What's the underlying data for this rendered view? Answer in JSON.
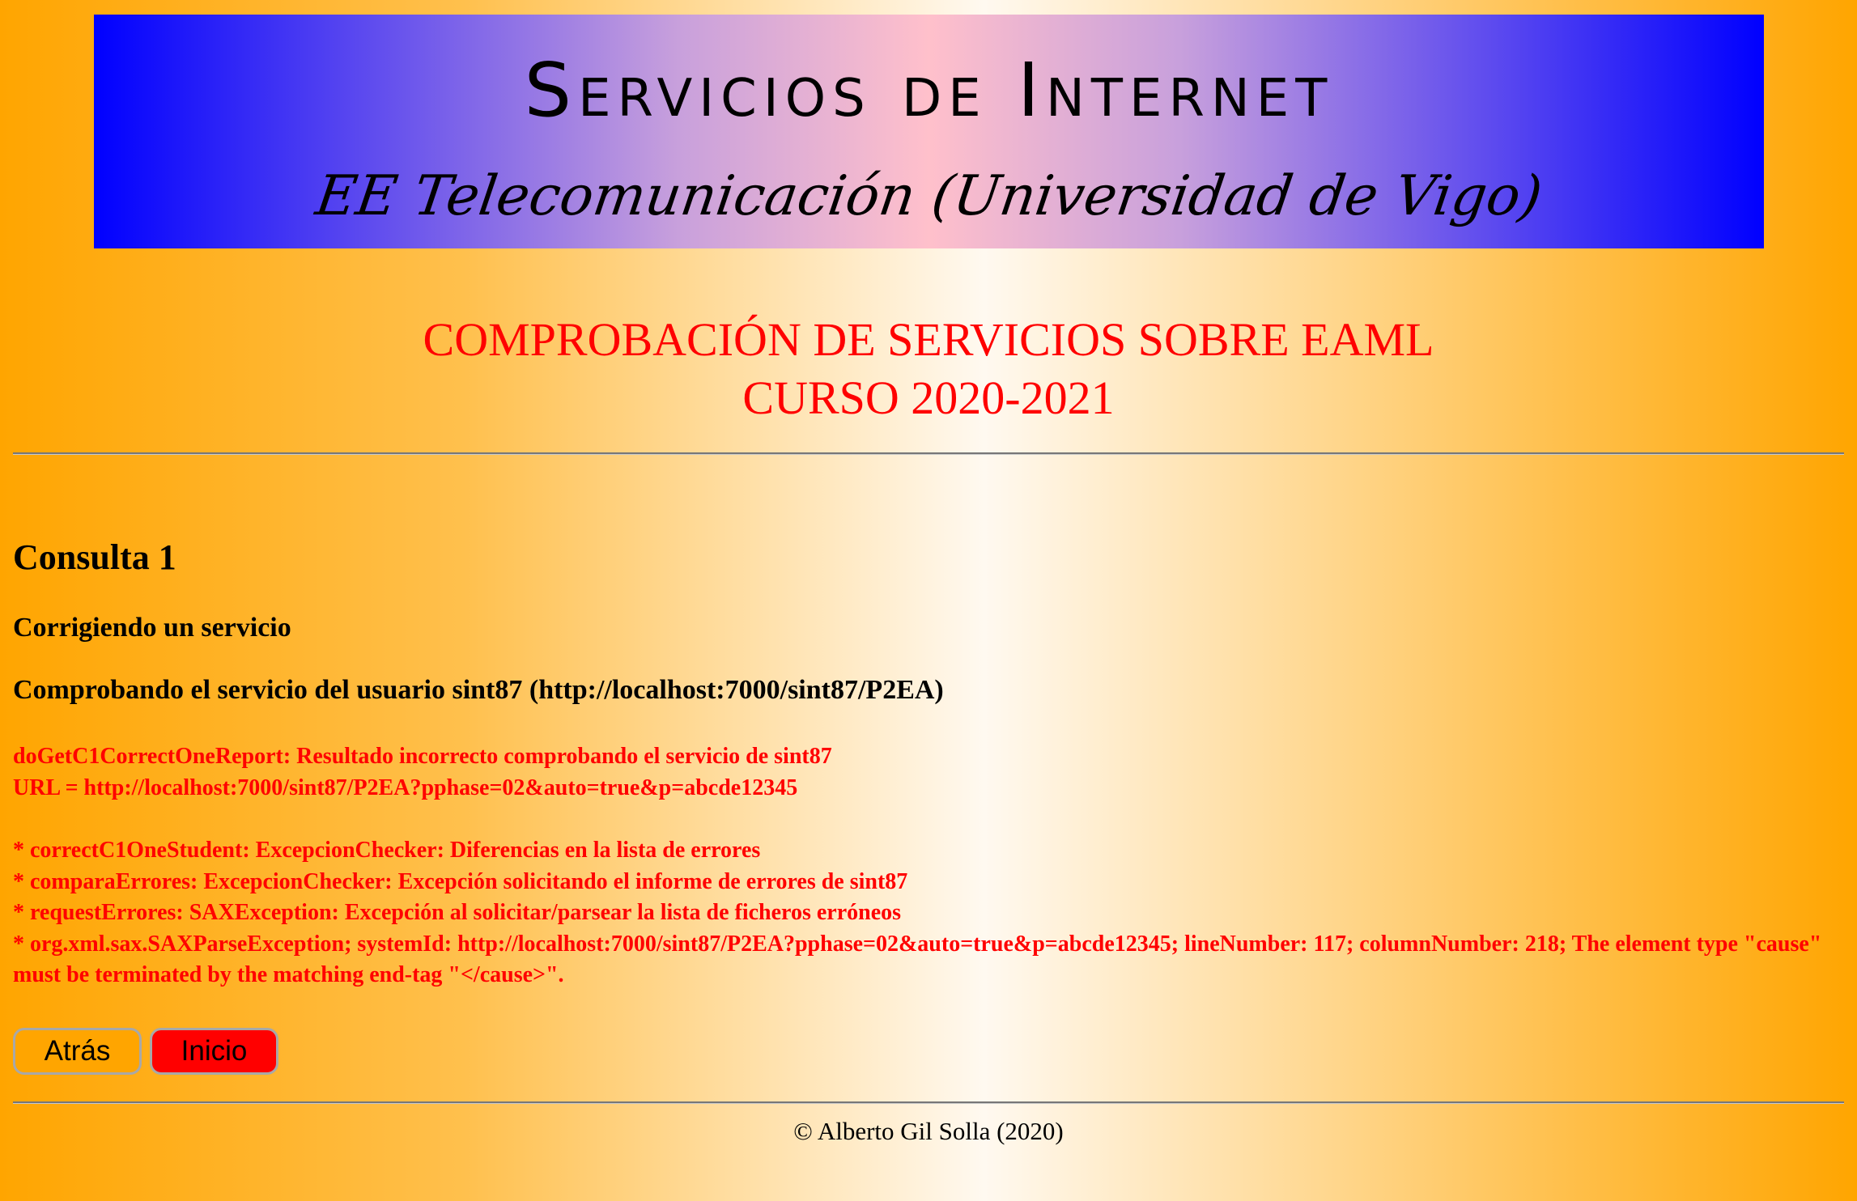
{
  "banner": {
    "title": "Servicios de Internet",
    "subtitle": "EE Telecomunicación (Universidad de Vigo)"
  },
  "heading": {
    "line1": "COMPROBACIÓN DE SERVICIOS SOBRE EAML",
    "line2": "CURSO 2020-2021"
  },
  "consulta": {
    "title": "Consulta 1",
    "subtitle": "Corrigiendo un servicio",
    "checking": "Comprobando el servicio del usuario sint87 (http://localhost:7000/sint87/P2EA)"
  },
  "report": {
    "line1": "doGetC1CorrectOneReport: Resultado incorrecto comprobando el servicio de sint87",
    "line2": "URL = http://localhost:7000/sint87/P2EA?pphase=02&auto=true&p=abcde12345"
  },
  "details": [
    "* correctC1OneStudent: ExcepcionChecker: Diferencias en la lista de errores",
    "* comparaErrores: ExcepcionChecker: Excepción solicitando el informe de errores de sint87",
    "* requestErrores: SAXException: Excepción al solicitar/parsear la lista de ficheros erróneos",
    "* org.xml.sax.SAXParseException; systemId: http://localhost:7000/sint87/P2EA?pphase=02&auto=true&p=abcde12345; lineNumber: 117; columnNumber: 218; The element type \"cause\" must be terminated by the matching end-tag \"</cause>\"."
  ],
  "buttons": {
    "back": "Atrás",
    "home": "Inicio"
  },
  "footer": "© Alberto Gil Solla (2020)",
  "colors": {
    "background": "#ffa500",
    "banner_edge": "#0000ff",
    "banner_center": "#ffc0cb",
    "error_text": "#ff0000",
    "home_button": "#ff0000",
    "back_button": "#ffa500"
  }
}
